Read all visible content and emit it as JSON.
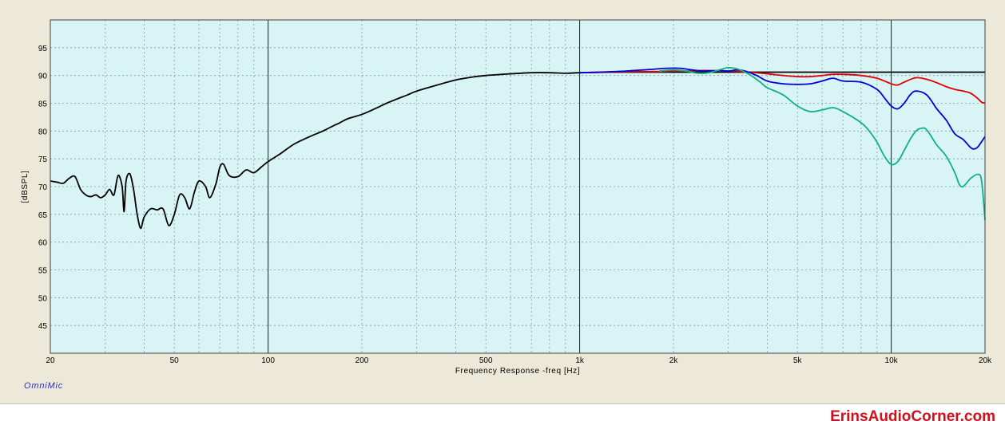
{
  "brand": "OmniMic",
  "watermark": "ErinsAudioCorner.com",
  "chart_data": {
    "type": "line",
    "xlabel": "Frequency Response -freq [Hz]",
    "ylabel": "[dBSPL]",
    "xscale": "log",
    "xlim": [
      20,
      20000
    ],
    "ylim": [
      40,
      100
    ],
    "x_ticks": [
      20,
      50,
      100,
      200,
      500,
      1000,
      2000,
      5000,
      10000,
      20000
    ],
    "x_tick_labels": [
      "20",
      "50",
      "100",
      "200",
      "500",
      "1k",
      "2k",
      "5k",
      "10k",
      "20k"
    ],
    "y_ticks": [
      45,
      50,
      55,
      60,
      65,
      70,
      75,
      80,
      85,
      90,
      95
    ],
    "grid": true,
    "plot_background": "#d8f4f4",
    "series": [
      {
        "color": "#000000",
        "points": [
          [
            20,
            71.0
          ],
          [
            21,
            70.8
          ],
          [
            22,
            70.6
          ],
          [
            23,
            71.5
          ],
          [
            24,
            71.8
          ],
          [
            25,
            69.5
          ],
          [
            26,
            68.5
          ],
          [
            27,
            68.2
          ],
          [
            28,
            68.5
          ],
          [
            29,
            68.0
          ],
          [
            30,
            68.5
          ],
          [
            31,
            69.5
          ],
          [
            32,
            68.5
          ],
          [
            33,
            72.0
          ],
          [
            34,
            70.0
          ],
          [
            34.5,
            65.5
          ],
          [
            35,
            71.0
          ],
          [
            36,
            72.3
          ],
          [
            37,
            69.5
          ],
          [
            38,
            65.0
          ],
          [
            39,
            62.5
          ],
          [
            40,
            64.5
          ],
          [
            42,
            66.0
          ],
          [
            44,
            65.8
          ],
          [
            46,
            66.0
          ],
          [
            48,
            63.0
          ],
          [
            50,
            65.0
          ],
          [
            52,
            68.5
          ],
          [
            54,
            68.0
          ],
          [
            56,
            66.0
          ],
          [
            58,
            69.0
          ],
          [
            60,
            71.0
          ],
          [
            63,
            70.0
          ],
          [
            65,
            68.0
          ],
          [
            68,
            70.5
          ],
          [
            70,
            73.5
          ],
          [
            72,
            74.0
          ],
          [
            75,
            72.0
          ],
          [
            80,
            71.8
          ],
          [
            85,
            73.0
          ],
          [
            90,
            72.5
          ],
          [
            95,
            73.5
          ],
          [
            100,
            74.5
          ],
          [
            110,
            76.0
          ],
          [
            120,
            77.5
          ],
          [
            130,
            78.5
          ],
          [
            140,
            79.3
          ],
          [
            150,
            80.0
          ],
          [
            160,
            80.8
          ],
          [
            170,
            81.5
          ],
          [
            180,
            82.2
          ],
          [
            200,
            83.0
          ],
          [
            220,
            84.0
          ],
          [
            240,
            85.0
          ],
          [
            260,
            85.8
          ],
          [
            280,
            86.5
          ],
          [
            300,
            87.2
          ],
          [
            350,
            88.3
          ],
          [
            400,
            89.2
          ],
          [
            450,
            89.7
          ],
          [
            500,
            90.0
          ],
          [
            600,
            90.3
          ],
          [
            700,
            90.5
          ],
          [
            800,
            90.5
          ],
          [
            900,
            90.4
          ],
          [
            1000,
            90.5
          ],
          [
            1200,
            90.6
          ],
          [
            1500,
            90.6
          ],
          [
            2000,
            90.6
          ],
          [
            3000,
            90.6
          ],
          [
            5000,
            90.6
          ],
          [
            10000,
            90.6
          ],
          [
            20000,
            90.6
          ]
        ]
      },
      {
        "color": "#e00000",
        "points": [
          [
            1000,
            90.5
          ],
          [
            1300,
            90.6
          ],
          [
            1500,
            90.7
          ],
          [
            1800,
            90.7
          ],
          [
            2000,
            90.8
          ],
          [
            2200,
            90.8
          ],
          [
            2500,
            90.9
          ],
          [
            3000,
            90.8
          ],
          [
            3500,
            90.6
          ],
          [
            4000,
            90.3
          ],
          [
            4500,
            90.0
          ],
          [
            5000,
            89.8
          ],
          [
            5500,
            89.8
          ],
          [
            6000,
            90.0
          ],
          [
            6500,
            90.2
          ],
          [
            7000,
            90.2
          ],
          [
            8000,
            90.0
          ],
          [
            9000,
            89.5
          ],
          [
            10000,
            88.5
          ],
          [
            10500,
            88.3
          ],
          [
            11000,
            88.8
          ],
          [
            12000,
            89.6
          ],
          [
            13000,
            89.3
          ],
          [
            14000,
            88.7
          ],
          [
            15000,
            88.0
          ],
          [
            16000,
            87.5
          ],
          [
            17000,
            87.2
          ],
          [
            18000,
            86.8
          ],
          [
            19000,
            85.8
          ],
          [
            19500,
            85.2
          ],
          [
            20000,
            85.0
          ]
        ]
      },
      {
        "color": "#0000d8",
        "points": [
          [
            1000,
            90.5
          ],
          [
            1300,
            90.7
          ],
          [
            1500,
            90.9
          ],
          [
            1700,
            91.1
          ],
          [
            1900,
            91.3
          ],
          [
            2100,
            91.3
          ],
          [
            2300,
            91.0
          ],
          [
            2500,
            90.8
          ],
          [
            2800,
            90.9
          ],
          [
            3000,
            90.8
          ],
          [
            3200,
            91.0
          ],
          [
            3400,
            90.8
          ],
          [
            3700,
            90.0
          ],
          [
            4000,
            89.0
          ],
          [
            4500,
            88.5
          ],
          [
            5000,
            88.4
          ],
          [
            5500,
            88.5
          ],
          [
            6000,
            89.0
          ],
          [
            6500,
            89.5
          ],
          [
            7000,
            89.0
          ],
          [
            8000,
            88.8
          ],
          [
            9000,
            87.5
          ],
          [
            9500,
            86.0
          ],
          [
            10000,
            84.5
          ],
          [
            10500,
            84.0
          ],
          [
            11000,
            85.0
          ],
          [
            11500,
            86.5
          ],
          [
            12000,
            87.2
          ],
          [
            13000,
            86.5
          ],
          [
            14000,
            84.0
          ],
          [
            15000,
            82.0
          ],
          [
            16000,
            79.5
          ],
          [
            17000,
            78.5
          ],
          [
            18000,
            77.0
          ],
          [
            18500,
            76.8
          ],
          [
            19000,
            77.2
          ],
          [
            20000,
            79.0
          ]
        ]
      },
      {
        "color": "#10b088",
        "points": [
          [
            1800,
            90.8
          ],
          [
            2000,
            91.0
          ],
          [
            2200,
            90.8
          ],
          [
            2400,
            90.4
          ],
          [
            2600,
            90.5
          ],
          [
            2800,
            91.0
          ],
          [
            3000,
            91.4
          ],
          [
            3200,
            91.2
          ],
          [
            3500,
            90.2
          ],
          [
            3800,
            88.8
          ],
          [
            4000,
            87.8
          ],
          [
            4500,
            86.5
          ],
          [
            5000,
            84.5
          ],
          [
            5500,
            83.5
          ],
          [
            6000,
            83.8
          ],
          [
            6500,
            84.2
          ],
          [
            7000,
            83.5
          ],
          [
            8000,
            81.5
          ],
          [
            8500,
            80.0
          ],
          [
            9000,
            78.0
          ],
          [
            9500,
            75.5
          ],
          [
            10000,
            74.0
          ],
          [
            10500,
            74.5
          ],
          [
            11000,
            76.5
          ],
          [
            11500,
            78.5
          ],
          [
            12000,
            80.0
          ],
          [
            12500,
            80.5
          ],
          [
            13000,
            80.2
          ],
          [
            14000,
            77.5
          ],
          [
            15000,
            75.5
          ],
          [
            16000,
            72.5
          ],
          [
            16500,
            70.5
          ],
          [
            17000,
            70.0
          ],
          [
            18000,
            71.5
          ],
          [
            19000,
            72.2
          ],
          [
            19500,
            71.0
          ],
          [
            20000,
            64.0
          ]
        ]
      }
    ]
  }
}
